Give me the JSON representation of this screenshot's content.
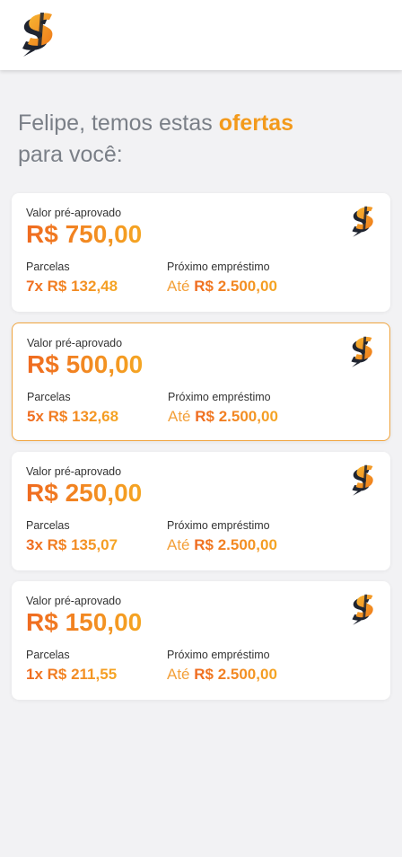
{
  "header": {
    "logo_icon": "dollar-logo-icon"
  },
  "title": {
    "prefix": "Felipe, temos estas ",
    "highlight": "ofertas",
    "suffix": "para você:"
  },
  "colors": {
    "accent_start": "#ef6a20",
    "accent_end": "#f5a623",
    "selected_border": "#f0a540"
  },
  "offers": [
    {
      "approved_label": "Valor pré-aprovado",
      "amount": "R$ 750,00",
      "installments_label": "Parcelas",
      "installments": "7x R$ 132,48",
      "next_label": "Próximo empréstimo",
      "next_prefix": "Até",
      "next_value": "R$ 2.500,00",
      "selected": false
    },
    {
      "approved_label": "Valor pré-aprovado",
      "amount": "R$ 500,00",
      "installments_label": "Parcelas",
      "installments": "5x R$ 132,68",
      "next_label": "Próximo empréstimo",
      "next_prefix": "Até",
      "next_value": "R$ 2.500,00",
      "selected": true
    },
    {
      "approved_label": "Valor pré-aprovado",
      "amount": "R$ 250,00",
      "installments_label": "Parcelas",
      "installments": "3x R$ 135,07",
      "next_label": "Próximo empréstimo",
      "next_prefix": "Até",
      "next_value": "R$ 2.500,00",
      "selected": false
    },
    {
      "approved_label": "Valor pré-aprovado",
      "amount": "R$ 150,00",
      "installments_label": "Parcelas",
      "installments": "1x R$ 211,55",
      "next_label": "Próximo empréstimo",
      "next_prefix": "Até",
      "next_value": "R$ 2.500,00",
      "selected": false
    }
  ]
}
